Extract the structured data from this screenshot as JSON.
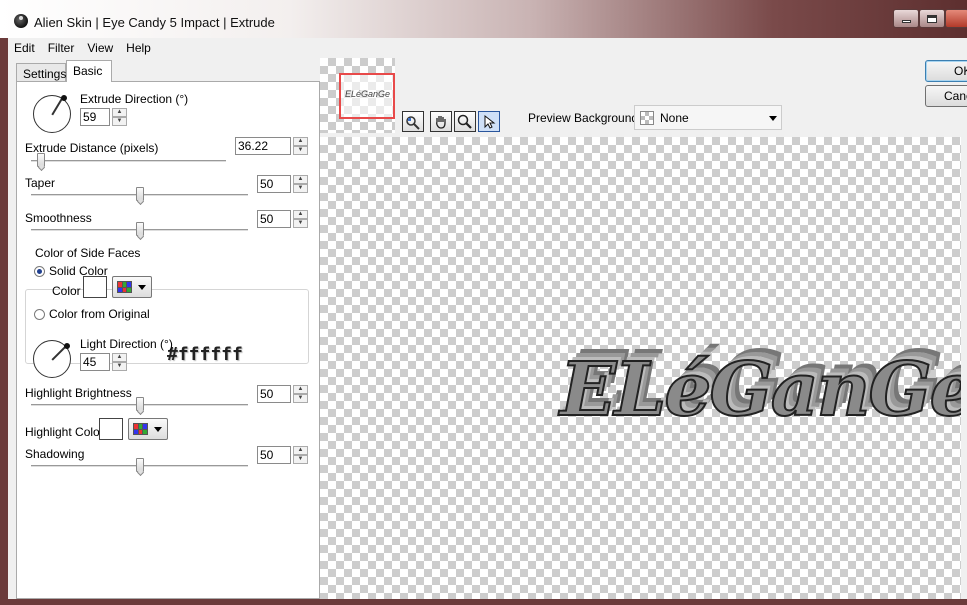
{
  "window": {
    "title": "Alien Skin | Eye Candy 5 Impact | Extrude"
  },
  "menu": [
    "Edit",
    "Filter",
    "View",
    "Help"
  ],
  "tabs": {
    "settings": "Settings",
    "basic": "Basic"
  },
  "basic": {
    "extrude_direction": {
      "label": "Extrude Direction (°)",
      "value": "59"
    },
    "extrude_distance": {
      "label": "Extrude Distance (pixels)",
      "value": "36.22",
      "fraction": 0.02
    },
    "taper": {
      "label": "Taper",
      "value": "50",
      "fraction": 0.5
    },
    "smoothness": {
      "label": "Smoothness",
      "value": "50",
      "fraction": 0.5
    },
    "side_faces": {
      "group_label": "Color of Side Faces",
      "solid_label": "Solid Color",
      "color_label": "Color",
      "original_label": "Color from Original",
      "selected": "solid",
      "color_note": "#ffffff"
    },
    "light_direction": {
      "label": "Light Direction (°)",
      "value": "45"
    },
    "highlight_brightness": {
      "label": "Highlight Brightness",
      "value": "50",
      "fraction": 0.5
    },
    "highlight_color": {
      "label": "Highlight Color"
    },
    "shadowing": {
      "label": "Shadowing",
      "value": "50",
      "fraction": 0.5
    }
  },
  "preview": {
    "background_label": "Preview Background:",
    "background_value": "None",
    "canvas_text": "ELéGanGe",
    "thumb_text": "ELéGanGe"
  },
  "buttons": {
    "ok": "OK",
    "cancel": "Cancel"
  }
}
